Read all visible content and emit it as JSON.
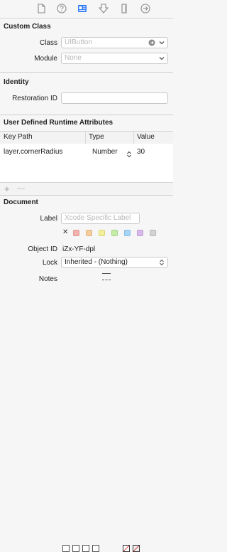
{
  "toolbar": {
    "icons": [
      "file-icon",
      "help-icon",
      "identity-icon",
      "attributes-icon",
      "size-icon",
      "connections-icon"
    ],
    "active": "identity-icon"
  },
  "custom_class": {
    "title": "Custom Class",
    "class_label": "Class",
    "class_placeholder": "UIButton",
    "module_label": "Module",
    "module_placeholder": "None"
  },
  "identity": {
    "title": "Identity",
    "restoration_id_label": "Restoration ID",
    "restoration_id_value": ""
  },
  "runtime_attributes": {
    "title": "User Defined Runtime Attributes",
    "columns": [
      "Key Path",
      "Type",
      "Value"
    ],
    "rows": [
      {
        "key_path": "layer.cornerRadius",
        "type": "Number",
        "value": "30"
      }
    ],
    "add_label": "+",
    "remove_label": "—"
  },
  "document": {
    "title": "Document",
    "label_label": "Label",
    "label_placeholder": "Xcode Specific Label",
    "clear_label": "✕",
    "swatches": [
      "#f2b2ad",
      "#f5cd9d",
      "#f2ef9c",
      "#c6ecaa",
      "#a8d4f5",
      "#d8b9ec",
      "#d3d3d3"
    ],
    "object_id_label": "Object ID",
    "object_id_value": "iZx-YF-dpl",
    "lock_label": "Lock",
    "lock_value": "Inherited - (Nothing)",
    "notes_label": "Notes"
  }
}
